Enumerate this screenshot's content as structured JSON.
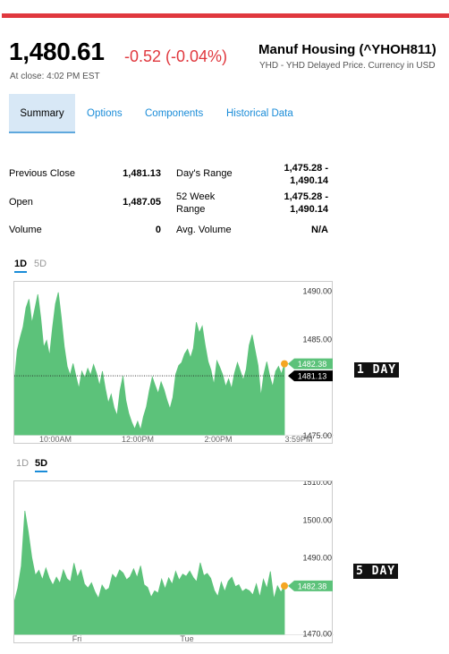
{
  "quote": {
    "price": "1,480.61",
    "change": "-0.52 (-0.04%)",
    "close_time": "At close: 4:02 PM EST",
    "name": "Manuf Housing (^YHOH811)",
    "subtitle": "YHD - YHD Delayed Price. Currency in USD",
    "colors": {
      "down": "#e0383e",
      "accent": "#1a8cd8",
      "chart_fill": "#5cc27a"
    }
  },
  "tabs": [
    {
      "label": "Summary",
      "active": true
    },
    {
      "label": "Options"
    },
    {
      "label": "Components"
    },
    {
      "label": "Historical Data"
    }
  ],
  "stats": {
    "previous_close": {
      "label": "Previous Close",
      "value": "1,481.13"
    },
    "open": {
      "label": "Open",
      "value": "1,487.05"
    },
    "volume": {
      "label": "Volume",
      "value": "0"
    },
    "days_range": {
      "label": "Day's Range",
      "value_line1": "1,475.28 -",
      "value_line2": "1,490.14"
    },
    "week52_range": {
      "label_line1": "52 Week",
      "label_line2": "Range",
      "value_line1": "1,475.28 -",
      "value_line2": "1,490.14"
    },
    "avg_volume": {
      "label": "Avg. Volume",
      "value": "N/A"
    }
  },
  "charts": {
    "one_day": {
      "range_tabs": [
        {
          "label": "1D",
          "active": true
        },
        {
          "label": "5D"
        }
      ],
      "y_ticks": [
        "1490.00",
        "1485.00",
        "1475.00"
      ],
      "x_ticks": [
        "10:00AM",
        "12:00PM",
        "2:00PM",
        "3:59PM"
      ],
      "current_label": "1482.38",
      "prev_close_label": "1481.13",
      "annotation": "1 DAY"
    },
    "five_day": {
      "range_tabs": [
        {
          "label": "1D"
        },
        {
          "label": "5D",
          "active": true
        }
      ],
      "y_ticks": [
        "1510.00",
        "1500.00",
        "1490.00",
        "1470.00"
      ],
      "x_ticks": [
        "Fri",
        "Tue"
      ],
      "current_label": "1482.38",
      "annotation": "5 DAY"
    }
  },
  "chart_data": [
    {
      "type": "area",
      "title": "",
      "ylim": [
        1475,
        1490.9
      ],
      "prev_close": 1481.13,
      "last": 1482.38,
      "x_labels": [
        "10:00AM",
        "12:00PM",
        "2:00PM",
        "3:59PM"
      ],
      "values": [
        1480.6,
        1483.8,
        1485.1,
        1486.2,
        1488.2,
        1489.1,
        1486.6,
        1488.1,
        1489.6,
        1487.2,
        1484.1,
        1484.8,
        1483.2,
        1486.1,
        1488.6,
        1489.8,
        1487.2,
        1484.2,
        1482.1,
        1481.2,
        1482.4,
        1481.1,
        1479.8,
        1481.6,
        1480.9,
        1481.9,
        1481.2,
        1482.3,
        1481.4,
        1480.1,
        1481.6,
        1479.8,
        1478.3,
        1479.2,
        1477.8,
        1477.0,
        1479.6,
        1481.1,
        1478.6,
        1477.2,
        1476.3,
        1475.6,
        1476.4,
        1475.5,
        1476.9,
        1477.9,
        1479.6,
        1481.0,
        1480.1,
        1479.3,
        1480.5,
        1479.7,
        1478.6,
        1477.7,
        1478.9,
        1481.3,
        1482.2,
        1482.5,
        1483.4,
        1483.9,
        1483.0,
        1484.0,
        1486.7,
        1485.6,
        1486.3,
        1484.3,
        1482.6,
        1481.7,
        1480.2,
        1482.7,
        1482.0,
        1481.2,
        1480.0,
        1480.8,
        1479.8,
        1481.4,
        1482.5,
        1481.6,
        1480.7,
        1481.8,
        1484.3,
        1485.4,
        1483.8,
        1482.2,
        1479.0,
        1481.3,
        1482.6,
        1481.1,
        1480.0,
        1481.6,
        1482.1,
        1481.3,
        1482.4
      ]
    },
    {
      "type": "area",
      "title": "",
      "ylim": [
        1469.6,
        1510
      ],
      "last": 1482.38,
      "x_labels": [
        "Fri",
        "Tue"
      ],
      "values": [
        1478.2,
        1481.8,
        1487.6,
        1502.2,
        1496.5,
        1489.8,
        1485.2,
        1486.5,
        1484.0,
        1487.1,
        1484.4,
        1482.6,
        1484.7,
        1483.1,
        1486.6,
        1484.3,
        1483.5,
        1488.4,
        1484.7,
        1486.6,
        1482.9,
        1481.8,
        1483.2,
        1480.8,
        1479.1,
        1482.6,
        1481.2,
        1481.8,
        1485.4,
        1484.4,
        1486.6,
        1485.8,
        1484.0,
        1484.8,
        1486.9,
        1484.6,
        1487.7,
        1482.7,
        1482.0,
        1479.4,
        1481.1,
        1480.5,
        1484.2,
        1481.6,
        1484.5,
        1482.8,
        1486.2,
        1483.9,
        1485.5,
        1484.9,
        1486.3,
        1484.6,
        1483.5,
        1488.5,
        1485.1,
        1485.7,
        1484.4,
        1481.2,
        1479.6,
        1483.4,
        1480.9,
        1483.6,
        1484.7,
        1482.2,
        1482.7,
        1480.9,
        1481.6,
        1481.1,
        1480.0,
        1482.9,
        1479.4,
        1484.1,
        1481.7,
        1486.2,
        1478.9,
        1482.4,
        1480.7,
        1482.38
      ]
    }
  ]
}
